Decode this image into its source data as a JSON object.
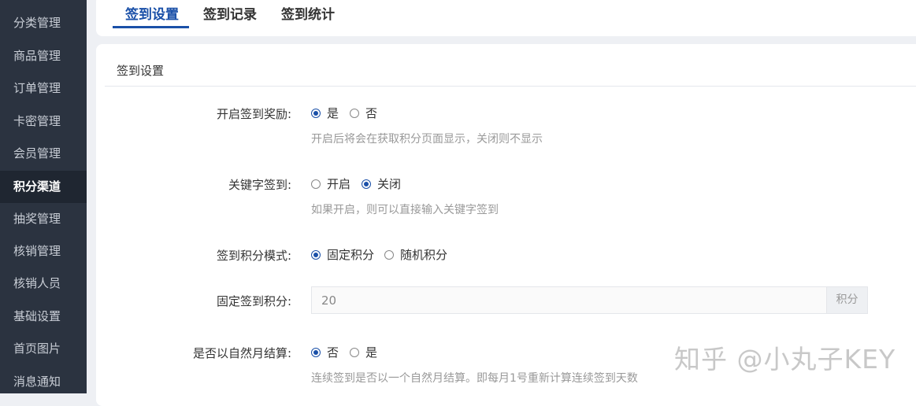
{
  "sidebar": {
    "items": [
      {
        "label": "分类管理"
      },
      {
        "label": "商品管理"
      },
      {
        "label": "订单管理"
      },
      {
        "label": "卡密管理"
      },
      {
        "label": "会员管理"
      },
      {
        "label": "积分渠道"
      },
      {
        "label": "抽奖管理"
      },
      {
        "label": "核销管理"
      },
      {
        "label": "核销人员"
      },
      {
        "label": "基础设置"
      },
      {
        "label": "首页图片"
      },
      {
        "label": "消息通知"
      }
    ],
    "active_item": "积分渠道"
  },
  "tabs": [
    {
      "label": "签到设置",
      "active": true
    },
    {
      "label": "签到记录",
      "active": false
    },
    {
      "label": "签到统计",
      "active": false
    }
  ],
  "section": {
    "title": "签到设置"
  },
  "form": {
    "enable_reward": {
      "label": "开启签到奖励:",
      "options": [
        "是",
        "否"
      ],
      "selected": "是",
      "help": "开启后将会在获取积分页面显示，关闭则不显示"
    },
    "keyword_signin": {
      "label": "关键字签到:",
      "options": [
        "开启",
        "关闭"
      ],
      "selected": "关闭",
      "help": "如果开启，则可以直接输入关键字签到"
    },
    "points_mode": {
      "label": "签到积分模式:",
      "options": [
        "固定积分",
        "随机积分"
      ],
      "selected": "固定积分"
    },
    "fixed_points": {
      "label": "固定签到积分:",
      "value": "20",
      "addon": "积分"
    },
    "natural_month": {
      "label": "是否以自然月结算:",
      "options": [
        "否",
        "是"
      ],
      "selected": "否",
      "help": "连续签到是否以一个自然月结算。即每月1号重新计算连续签到天数"
    }
  },
  "watermark": "知乎 @小丸子KEY",
  "colors": {
    "accent": "#1a50a8",
    "sidebar_bg": "#2b3340",
    "sidebar_active_bg": "#1f2631"
  }
}
